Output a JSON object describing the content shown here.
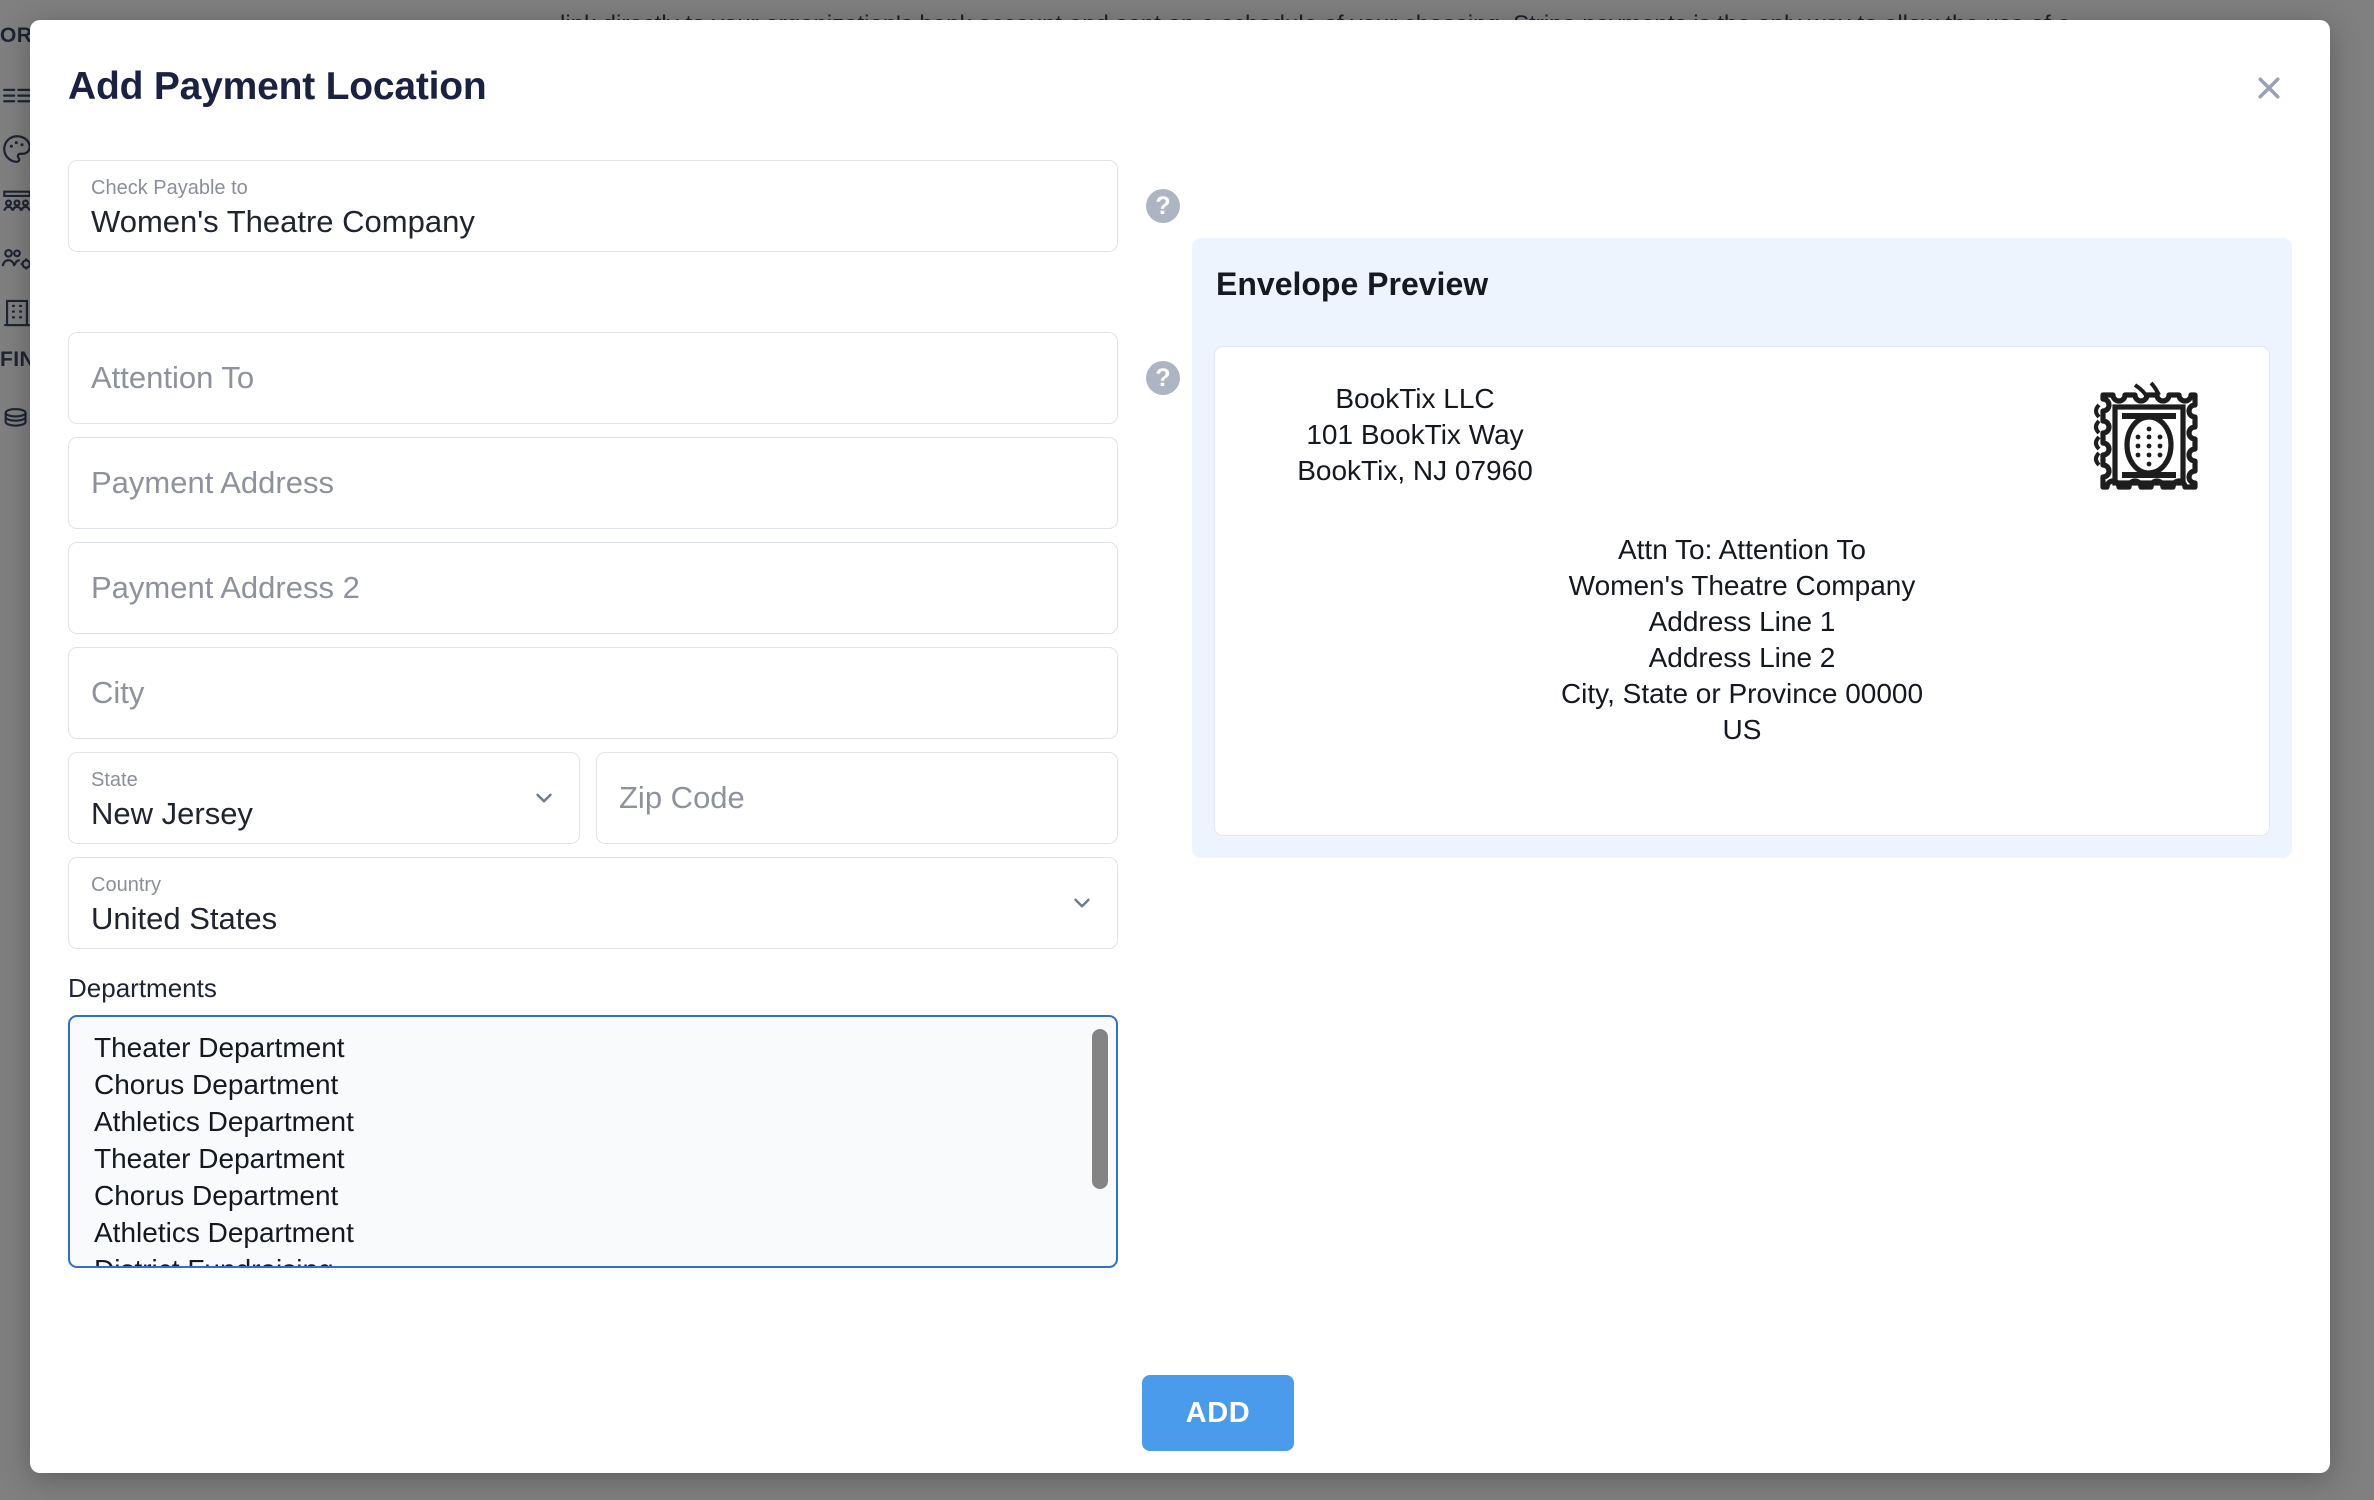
{
  "background": {
    "text_line1": "link directly to your organization's bank account and sent on a schedule of your choosing. Stripe payments is the only way to allow the use of a",
    "text_line2": "",
    "rail_labels": [
      "ORG",
      "FINA"
    ],
    "rail_icons": [
      "list-icon",
      "palette-icon",
      "audience-seats-icon",
      "people-gear-icon",
      "building-icon",
      "coins-icon"
    ],
    "overlay_color": "#808080"
  },
  "modal": {
    "title": "Add Payment Location",
    "close_label": "×",
    "accent_color": "#4a9bec",
    "focus_border_color": "#2f6fd0"
  },
  "form": {
    "check_payable": {
      "label": "Check Payable to",
      "value": "Women's Theatre Company",
      "help": "?"
    },
    "attention_to": {
      "placeholder": "Attention To",
      "value": "",
      "help": "?"
    },
    "payment_address": {
      "placeholder": "Payment Address",
      "value": ""
    },
    "payment_address_2": {
      "placeholder": "Payment Address 2",
      "value": ""
    },
    "city": {
      "placeholder": "City",
      "value": ""
    },
    "state": {
      "label": "State",
      "value": "New Jersey"
    },
    "zip_code": {
      "placeholder": "Zip Code",
      "value": ""
    },
    "country": {
      "label": "Country",
      "value": "United States"
    },
    "departments": {
      "label": "Departments",
      "items": [
        "Theater Department",
        "Chorus Department",
        "Athletics Department",
        "Theater Department",
        "Chorus Department",
        "Athletics Department",
        "District Fundraising"
      ]
    }
  },
  "preview": {
    "title": "Envelope Preview",
    "return_address": [
      "BookTix LLC",
      "101 BookTix Way",
      "BookTix, NJ 07960"
    ],
    "destination_address": [
      "Attn To: Attention To",
      "Women's Theatre Company",
      "Address Line 1",
      "Address Line 2",
      "City, State or Province 00000",
      "US"
    ],
    "stamp_icon": "postage-stamp-icon"
  },
  "footer": {
    "add_label": "ADD"
  }
}
